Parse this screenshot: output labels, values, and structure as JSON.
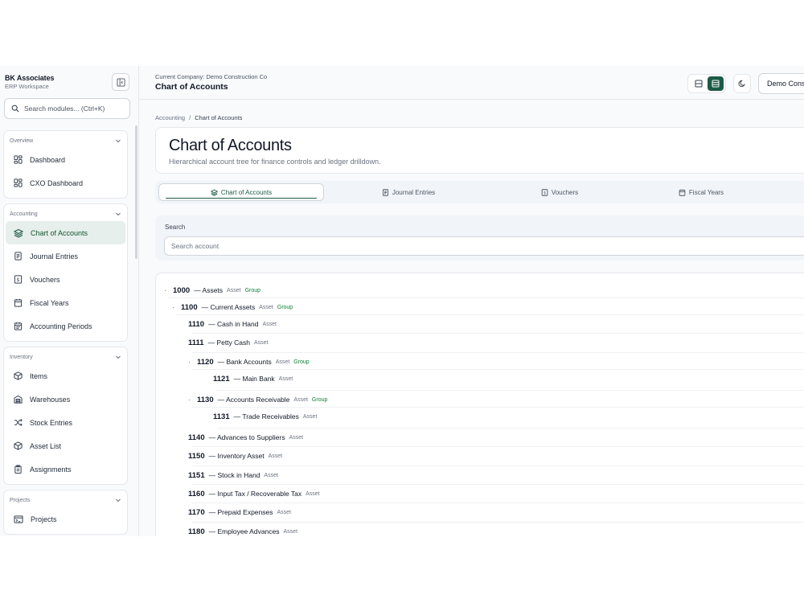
{
  "brand": {
    "name": "BK Associates",
    "subtitle": "ERP Workspace"
  },
  "sidebar": {
    "search_placeholder": "Search modules... (Ctrl+K)",
    "sections": [
      {
        "label": "Overview",
        "items": [
          {
            "label": "Dashboard",
            "icon": "grid-icon"
          },
          {
            "label": "CXO Dashboard",
            "icon": "grid-icon"
          }
        ]
      },
      {
        "label": "Accounting",
        "items": [
          {
            "label": "Chart of Accounts",
            "icon": "layers-icon",
            "active": true
          },
          {
            "label": "Journal Entries",
            "icon": "journal-icon"
          },
          {
            "label": "Vouchers",
            "icon": "voucher-icon"
          },
          {
            "label": "Fiscal Years",
            "icon": "calendar-icon"
          },
          {
            "label": "Accounting Periods",
            "icon": "calendar-check-icon"
          }
        ]
      },
      {
        "label": "Inventory",
        "items": [
          {
            "label": "Items",
            "icon": "box-icon"
          },
          {
            "label": "Warehouses",
            "icon": "warehouse-icon"
          },
          {
            "label": "Stock Entries",
            "icon": "shuffle-icon"
          },
          {
            "label": "Asset List",
            "icon": "box-icon"
          },
          {
            "label": "Assignments",
            "icon": "clipboard-icon"
          }
        ]
      },
      {
        "label": "Projects",
        "items": [
          {
            "label": "Projects",
            "icon": "projects-icon"
          }
        ]
      }
    ]
  },
  "topbar": {
    "company_line": "Current Company: Demo Construction Co",
    "title": "Chart of Accounts",
    "company_button": "Demo Cons"
  },
  "breadcrumb": {
    "parent": "Accounting",
    "separator": "/",
    "current": "Chart of Accounts"
  },
  "header": {
    "title": "Chart of Accounts",
    "subtitle": "Hierarchical account tree for finance controls and ledger drilldown."
  },
  "tabs": [
    {
      "label": "Chart of Accounts",
      "icon": "layers-icon",
      "active": true
    },
    {
      "label": "Journal Entries",
      "icon": "journal-icon"
    },
    {
      "label": "Vouchers",
      "icon": "voucher-icon"
    },
    {
      "label": "Fiscal Years",
      "icon": "calendar-icon"
    }
  ],
  "search": {
    "label": "Search",
    "placeholder": "Search account"
  },
  "accounts": [
    {
      "code": "1000",
      "name": "Assets",
      "type": "Asset",
      "group": "Group",
      "bullet": true,
      "level": 0
    },
    {
      "code": "1100",
      "name": "Current Assets",
      "type": "Asset",
      "group": "Group",
      "bullet": true,
      "level": 1
    },
    {
      "code": "1110",
      "name": "Cash in Hand",
      "type": "Asset",
      "level": 2
    },
    {
      "code": "1111",
      "name": "Petty Cash",
      "type": "Asset",
      "level": 2
    },
    {
      "code": "1120",
      "name": "Bank Accounts",
      "type": "Asset",
      "group": "Group",
      "bullet": true,
      "level": 2
    },
    {
      "code": "1121",
      "name": "Main Bank",
      "type": "Asset",
      "level": 3
    },
    {
      "code": "1130",
      "name": "Accounts Receivable",
      "type": "Asset",
      "group": "Group",
      "bullet": true,
      "level": 2
    },
    {
      "code": "1131",
      "name": "Trade Receivables",
      "type": "Asset",
      "level": 3
    },
    {
      "code": "1140",
      "name": "Advances to Suppliers",
      "type": "Asset",
      "level": 2
    },
    {
      "code": "1150",
      "name": "Inventory Asset",
      "type": "Asset",
      "level": 2
    },
    {
      "code": "1151",
      "name": "Stock in Hand",
      "type": "Asset",
      "level": 2
    },
    {
      "code": "1160",
      "name": "Input Tax / Recoverable Tax",
      "type": "Asset",
      "level": 2
    },
    {
      "code": "1170",
      "name": "Prepaid Expenses",
      "type": "Asset",
      "level": 2
    },
    {
      "code": "1180",
      "name": "Employee Advances",
      "type": "Asset",
      "level": 2
    }
  ],
  "colors": {
    "accent": "#1d5a45",
    "group_badge": "#15803d",
    "active_nav_bg": "#e6efeb"
  }
}
